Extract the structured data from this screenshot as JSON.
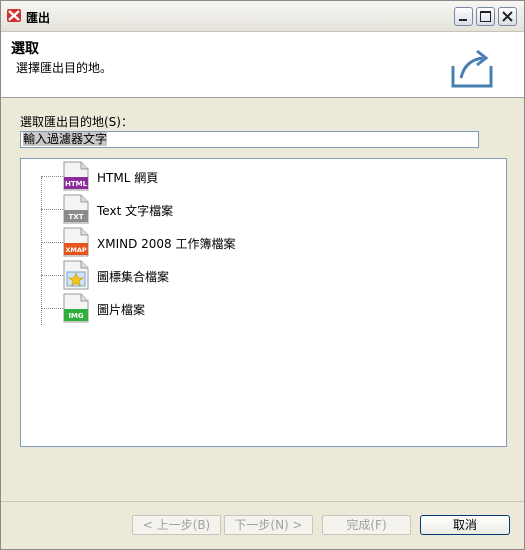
{
  "window": {
    "title": "匯出"
  },
  "banner": {
    "title": "選取",
    "description": "選擇匯出目的地。",
    "icon": "export-tray-icon"
  },
  "destination": {
    "label": "選取匯出目的地(S)：",
    "filter_value": "輸入過濾器文字"
  },
  "tree": {
    "items": [
      {
        "label": "HTML 網頁",
        "badge": "HTML",
        "badge_color": "#8e2c9c",
        "icon": "html-file-icon"
      },
      {
        "label": "Text 文字檔案",
        "badge": "TXT",
        "badge_color": "#8c8c8c",
        "icon": "txt-file-icon"
      },
      {
        "label": "XMIND 2008 工作簿檔案",
        "badge": "XMAP",
        "badge_color": "#e8541e",
        "icon": "xmap-file-icon"
      },
      {
        "label": "圖標集合檔案",
        "badge": "",
        "badge_color": "#f5c518",
        "icon": "marker-file-icon"
      },
      {
        "label": "圖片檔案",
        "badge": "IMG",
        "badge_color": "#2eae3c",
        "icon": "img-file-icon"
      }
    ]
  },
  "buttons": {
    "back": "< 上一步(B)",
    "next": "下一步(N) >",
    "finish": "完成(F)",
    "cancel": "取消"
  }
}
